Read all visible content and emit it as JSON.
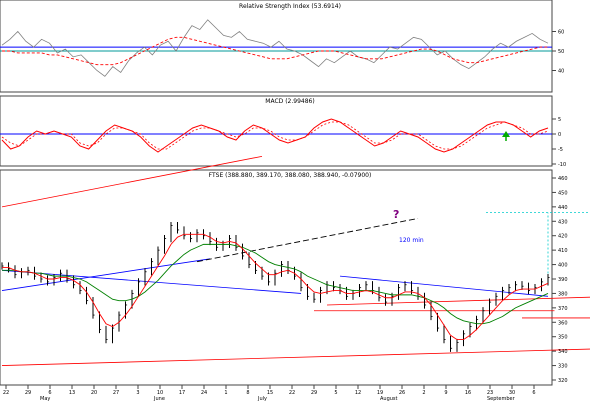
{
  "panels": {
    "rsi": {
      "title": "Relative Strength Index (53.6914)"
    },
    "macd": {
      "title": "MACD (2.99486)"
    },
    "price": {
      "title": "FTSE (388.880, 389.170, 388.080, 388.940, -0.07900)"
    }
  },
  "annotations": {
    "target_label": "120 min",
    "question_mark": "?"
  },
  "colors": {
    "price_bar": "#000000",
    "ma_short": "#ff0000",
    "ma_long": "#008000",
    "trendline_blue": "#0000ff",
    "trendline_red": "#ff0000",
    "rsi_line": "#808080",
    "rsi_signal": "#ff0000",
    "macd_signal": "#ff0000",
    "question_mark": "#800080",
    "arrow": "#00aa00",
    "target_dotted": "#00cccc"
  },
  "chart_data": [
    {
      "type": "line",
      "panel": "rsi",
      "title": "Relative Strength Index (53.6914)",
      "ylim": [
        30,
        70
      ],
      "y_ticks": [
        "60",
        "50",
        "40"
      ],
      "reference_lines": [
        52,
        50
      ],
      "series": [
        {
          "values": [
            53,
            56,
            60,
            55,
            52,
            56,
            54,
            49,
            51,
            47,
            48,
            44,
            40,
            37,
            42,
            39,
            45,
            49,
            52,
            48,
            53,
            55,
            50,
            57,
            63,
            61,
            66,
            62,
            58,
            57,
            60,
            56,
            55,
            54,
            52,
            55,
            51,
            50,
            48,
            45,
            42,
            46,
            44,
            47,
            50,
            47,
            46,
            44,
            48,
            52,
            51,
            54,
            57,
            56,
            52,
            48,
            50,
            46,
            43,
            41,
            44,
            47,
            51,
            54,
            52,
            55,
            57,
            59,
            56,
            54
          ]
        },
        {
          "values": [
            50,
            50,
            49,
            49,
            49,
            49,
            48,
            48,
            47,
            46,
            45,
            44,
            43,
            43,
            43,
            44,
            46,
            48,
            50,
            52,
            54,
            56,
            57,
            57,
            56,
            55,
            54,
            53,
            52,
            51,
            50,
            49,
            48,
            47,
            46,
            46,
            46,
            47,
            48,
            49,
            50,
            50,
            50,
            49,
            48,
            47,
            46,
            46,
            46,
            47,
            48,
            49,
            50,
            51,
            51,
            50,
            48,
            46,
            45,
            44,
            44,
            45,
            46,
            47,
            48,
            49,
            50,
            51,
            52,
            52
          ]
        }
      ]
    },
    {
      "type": "line",
      "panel": "macd",
      "title": "MACD (2.99486)",
      "ylim": [
        -10,
        10
      ],
      "y_ticks": [
        "5",
        "0",
        "-5",
        "-10"
      ],
      "reference_lines": [
        0
      ],
      "series": [
        {
          "values": [
            -2,
            -5,
            -4,
            -1,
            1,
            0,
            1,
            0,
            -1,
            -4,
            -5,
            -2,
            1,
            3,
            2,
            1,
            -1,
            -4,
            -6,
            -4,
            -2,
            0,
            2,
            3,
            2,
            1,
            -1,
            -2,
            1,
            3,
            2,
            0,
            -2,
            -3,
            -2,
            -1,
            2,
            4,
            5,
            4,
            2,
            0,
            -2,
            -4,
            -3,
            -1,
            1,
            0,
            -1,
            -3,
            -5,
            -6,
            -5,
            -3,
            -1,
            1,
            3,
            4,
            4,
            3,
            1,
            -1,
            1,
            2
          ]
        },
        {
          "values": [
            -1,
            -3,
            -4,
            -2,
            0,
            0,
            1,
            0,
            0,
            -3,
            -4,
            -3,
            0,
            2,
            2,
            1,
            0,
            -3,
            -5,
            -5,
            -3,
            -1,
            1,
            2,
            2,
            1,
            0,
            -1,
            0,
            2,
            2,
            1,
            -1,
            -2,
            -2,
            -1,
            1,
            3,
            4,
            4,
            3,
            1,
            -1,
            -3,
            -3,
            -2,
            0,
            0,
            0,
            -2,
            -4,
            -5,
            -5,
            -4,
            -2,
            0,
            2,
            3,
            4,
            3,
            2,
            0,
            0,
            1
          ]
        }
      ]
    },
    {
      "type": "candlestick",
      "panel": "price",
      "title": "FTSE (388.880, 389.170, 388.080, 388.940, -0.07900)",
      "ylim": [
        320,
        460
      ],
      "y_ticks": [
        "460",
        "450",
        "440",
        "430",
        "420",
        "410",
        "400",
        "390",
        "380",
        "370",
        "360",
        "350",
        "340",
        "330",
        "320"
      ],
      "x_ticks": [
        "22",
        "29",
        "6",
        "13",
        "20",
        "27",
        "3",
        "10",
        "17",
        "24",
        "1",
        "8",
        "15",
        "22",
        "29",
        "5",
        "12",
        "19",
        "26",
        "2",
        "9",
        "16",
        "23",
        "30",
        "6"
      ],
      "x_months": [
        "May",
        "June",
        "July",
        "August",
        "September"
      ],
      "close": [
        399,
        397,
        393,
        395,
        396,
        392,
        390,
        388,
        391,
        394,
        390,
        386,
        382,
        375,
        365,
        355,
        348,
        356,
        365,
        372,
        380,
        388,
        395,
        402,
        410,
        418,
        427,
        424,
        420,
        418,
        422,
        420,
        416,
        412,
        414,
        418,
        412,
        406,
        400,
        396,
        392,
        388,
        394,
        400,
        396,
        392,
        384,
        378,
        376,
        382,
        386,
        384,
        382,
        378,
        380,
        384,
        386,
        382,
        377,
        374,
        378,
        384,
        386,
        382,
        378,
        372,
        364,
        356,
        348,
        342,
        346,
        352,
        357,
        362,
        368,
        374,
        378,
        382,
        384,
        386,
        385,
        382,
        384,
        388,
        391
      ],
      "ma_short": [
        398,
        398,
        396,
        395,
        395,
        394,
        392,
        390,
        390,
        391,
        391,
        389,
        386,
        381,
        374,
        366,
        359,
        357,
        360,
        365,
        371,
        378,
        385,
        392,
        399,
        406,
        414,
        419,
        421,
        421,
        421,
        421,
        419,
        416,
        415,
        416,
        415,
        411,
        406,
        401,
        397,
        393,
        393,
        395,
        396,
        394,
        390,
        385,
        381,
        380,
        381,
        382,
        382,
        380,
        380,
        381,
        382,
        381,
        379,
        377,
        377,
        379,
        381,
        381,
        380,
        377,
        372,
        365,
        358,
        351,
        348,
        348,
        351,
        355,
        360,
        365,
        370,
        375,
        379,
        382,
        383,
        383,
        383,
        385,
        387
      ],
      "ma_long": [
        396,
        396,
        396,
        395,
        395,
        394,
        394,
        393,
        392,
        392,
        392,
        391,
        390,
        388,
        385,
        382,
        379,
        376,
        375,
        375,
        376,
        378,
        381,
        385,
        389,
        394,
        399,
        403,
        407,
        410,
        412,
        414,
        414,
        414,
        414,
        414,
        413,
        412,
        410,
        408,
        405,
        402,
        400,
        399,
        398,
        397,
        395,
        392,
        390,
        388,
        386,
        385,
        384,
        383,
        382,
        382,
        382,
        382,
        381,
        380,
        379,
        379,
        379,
        379,
        378,
        377,
        375,
        373,
        370,
        366,
        363,
        361,
        360,
        359,
        359,
        360,
        362,
        364,
        367,
        370,
        372,
        374,
        376,
        378,
        380
      ],
      "trendlines": [
        {
          "color": "blue",
          "from": [
            0,
            396
          ],
          "to": [
            46,
            380
          ]
        },
        {
          "color": "blue",
          "from": [
            52,
            392
          ],
          "to": [
            84,
            378
          ]
        },
        {
          "color": "blue",
          "from": [
            0,
            382
          ],
          "to": [
            32,
            404
          ]
        },
        {
          "color": "red",
          "from": [
            0,
            440
          ],
          "to": [
            40,
            475
          ]
        },
        {
          "color": "red",
          "from": [
            50,
            372
          ],
          "to": [
            95,
            378
          ]
        },
        {
          "color": "red",
          "from": [
            48,
            368
          ],
          "to": [
            85,
            368
          ]
        },
        {
          "color": "red",
          "from": [
            80,
            363
          ],
          "to": [
            95,
            363
          ]
        },
        {
          "color": "red",
          "from": [
            0,
            330
          ],
          "to": [
            95,
            342
          ]
        },
        {
          "color": "dashed",
          "from": [
            30,
            402
          ],
          "to": [
            64,
            432
          ]
        }
      ],
      "target": {
        "from_close": 391,
        "to": 436
      }
    }
  ]
}
